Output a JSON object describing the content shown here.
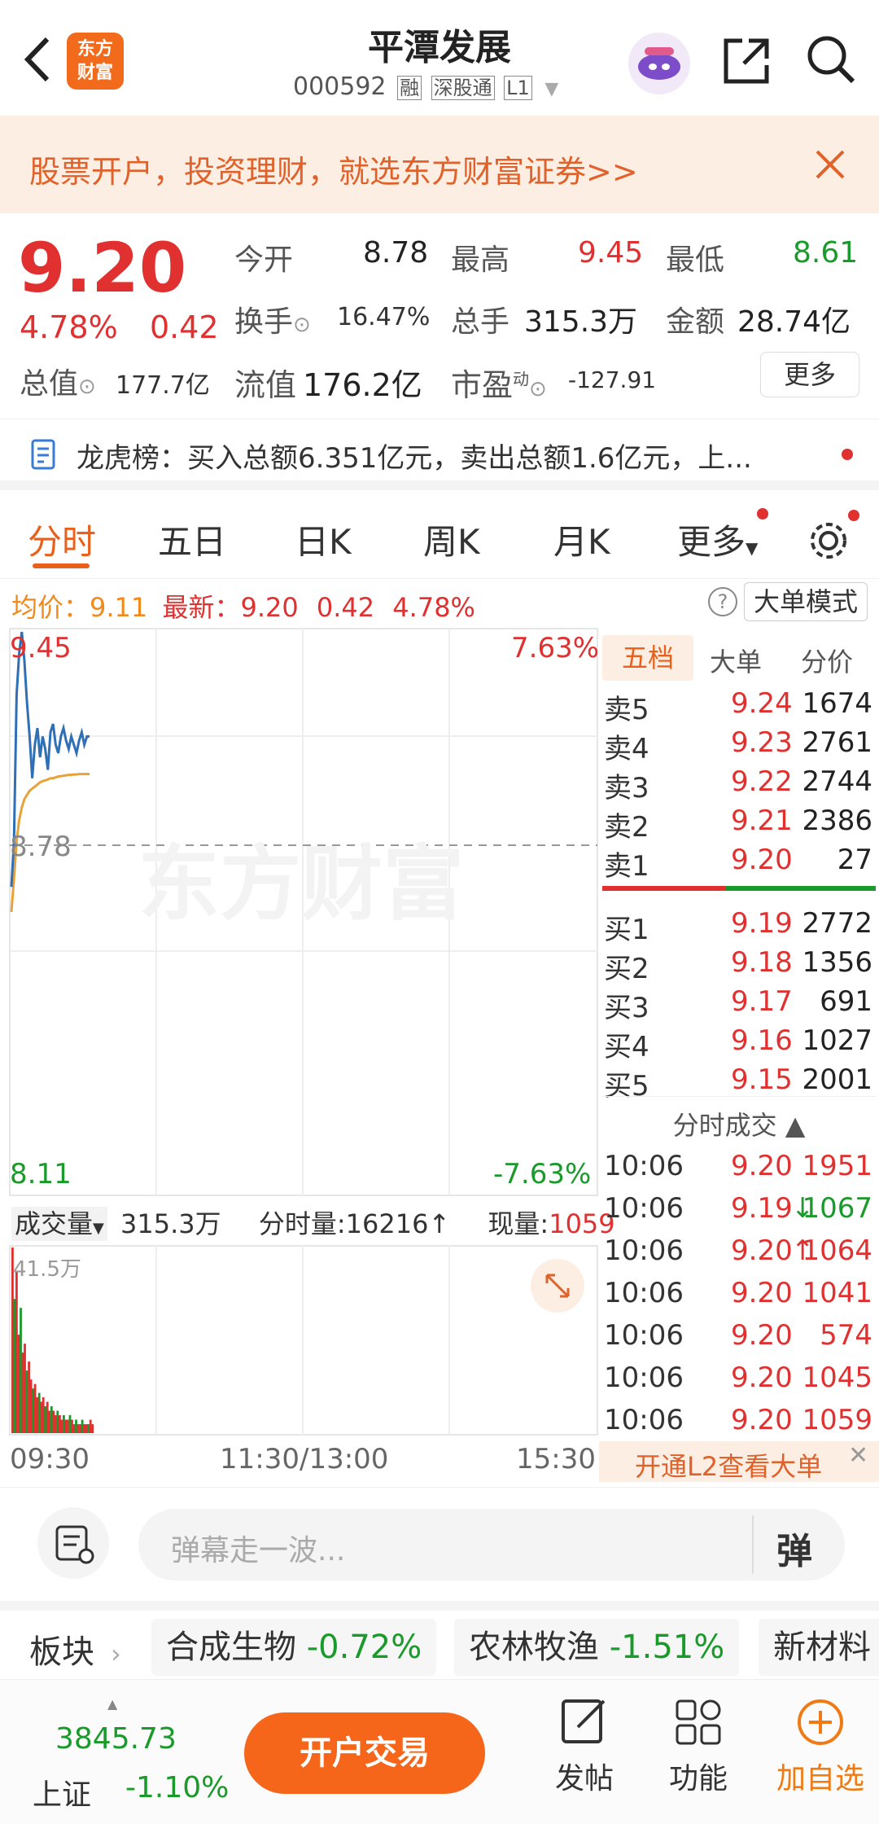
{
  "header": {
    "title": "平潭发展",
    "code": "000592",
    "tags": [
      "融",
      "深股通",
      "L1"
    ],
    "logo_text_top": "东方",
    "logo_text_bottom": "财富"
  },
  "banner": {
    "text": "股票开户，投资理财，就选东方财富证券>>"
  },
  "quote": {
    "price": "9.20",
    "change_pct": "4.78%",
    "change": "0.42",
    "open_label": "今开",
    "open": "8.78",
    "high_label": "最高",
    "high": "9.45",
    "low_label": "最低",
    "low": "8.61",
    "turnover_rate_label": "换手",
    "turnover_rate": "16.47%",
    "volume_label": "总手",
    "volume": "315.3万",
    "amount_label": "金额",
    "amount": "28.74亿",
    "total_mv_label": "总值",
    "total_mv": "177.7亿",
    "float_mv_label": "流值",
    "float_mv": "176.2亿",
    "pe_label": "市盈",
    "pe_sup": "动",
    "pe": "-127.91",
    "more_button": "更多"
  },
  "notice": {
    "text": "龙虎榜：买入总额6.351亿元，卖出总额1.6亿元，上..."
  },
  "tabs": {
    "items": [
      "分时",
      "五日",
      "日K",
      "周K",
      "月K",
      "更多"
    ],
    "active": 0
  },
  "chart_bar": {
    "avg_label": "均价：",
    "avg": "9.11",
    "latest_label": "最新：",
    "latest": "9.20",
    "change": "0.42",
    "change_pct": "4.78%",
    "mode_button": "大单模式"
  },
  "chart_data": {
    "type": "line",
    "price_axis": {
      "max": "9.45",
      "mid": "8.78",
      "min": "8.11",
      "max_pct": "7.63%",
      "min_pct": "-7.63%"
    },
    "time_axis": [
      "09:30",
      "11:30/13:00",
      "15:30"
    ],
    "ylim": [
      8.11,
      9.45
    ],
    "series": [
      {
        "values": [
          8.84,
          8.95,
          9.3,
          9.4,
          9.45,
          9.38,
          9.28,
          9.2,
          9.1,
          9.18,
          9.22,
          9.15,
          9.2,
          9.17,
          9.12,
          9.21,
          9.23,
          9.18,
          9.16,
          9.2,
          9.22,
          9.19,
          9.17,
          9.2,
          9.18,
          9.16,
          9.19,
          9.21,
          9.18,
          9.2,
          9.2
        ]
      },
      {
        "values": [
          8.78,
          8.86,
          8.95,
          9.0,
          9.03,
          9.05,
          9.06,
          9.07,
          9.075,
          9.08,
          9.085,
          9.09,
          9.093,
          9.095,
          9.097,
          9.1,
          9.1,
          9.102,
          9.104,
          9.105,
          9.106,
          9.107,
          9.108,
          9.108,
          9.109,
          9.109,
          9.11,
          9.11,
          9.11,
          9.11,
          9.11
        ]
      }
    ],
    "watermark": "东方财富",
    "volume": {
      "label": "成交量",
      "total": "315.3万",
      "minute_label": "分时量:",
      "minute": "16216↑",
      "current_label": "现量:",
      "current": "1059",
      "max_label": "41.5万",
      "values": [
        41.5,
        30,
        36,
        22,
        28,
        18,
        20,
        14,
        16,
        12,
        10,
        11,
        8,
        9,
        7,
        8,
        6,
        7,
        5,
        6,
        5,
        4,
        5,
        4,
        3,
        4,
        3,
        3,
        4,
        3,
        2,
        3,
        2,
        2,
        3,
        2,
        2,
        2,
        3,
        2
      ]
    }
  },
  "orderbook": {
    "tabs": [
      "五档",
      "大单",
      "分价"
    ],
    "asks": [
      {
        "label": "卖5",
        "price": "9.24",
        "vol": "1674"
      },
      {
        "label": "卖4",
        "price": "9.23",
        "vol": "2761"
      },
      {
        "label": "卖3",
        "price": "9.22",
        "vol": "2744"
      },
      {
        "label": "卖2",
        "price": "9.21",
        "vol": "2386"
      },
      {
        "label": "卖1",
        "price": "9.20",
        "vol": "27"
      }
    ],
    "bids": [
      {
        "label": "买1",
        "price": "9.19",
        "vol": "2772"
      },
      {
        "label": "买2",
        "price": "9.18",
        "vol": "1356"
      },
      {
        "label": "买3",
        "price": "9.17",
        "vol": "691"
      },
      {
        "label": "买4",
        "price": "9.16",
        "vol": "1027"
      },
      {
        "label": "买5",
        "price": "9.15",
        "vol": "2001"
      }
    ],
    "ticks_title": "分时成交",
    "ticks": [
      {
        "time": "10:06",
        "price": "9.20",
        "vol": "1951",
        "arrow": ""
      },
      {
        "time": "10:06",
        "price": "9.19",
        "vol": "1067",
        "arrow": "↓"
      },
      {
        "time": "10:06",
        "price": "9.20",
        "vol": "1064",
        "arrow": "↑"
      },
      {
        "time": "10:06",
        "price": "9.20",
        "vol": "1041",
        "arrow": ""
      },
      {
        "time": "10:06",
        "price": "9.20",
        "vol": "574",
        "arrow": ""
      },
      {
        "time": "10:06",
        "price": "9.20",
        "vol": "1045",
        "arrow": ""
      },
      {
        "time": "10:06",
        "price": "9.20",
        "vol": "1059",
        "arrow": ""
      }
    ],
    "l2_text": "开通L2查看大单"
  },
  "danmu": {
    "placeholder": "弹幕走一波...",
    "toggle": "弹"
  },
  "sector": {
    "label": "板块",
    "items": [
      {
        "name": "合成生物",
        "pct": "-0.72%"
      },
      {
        "name": "农林牧渔",
        "pct": "-1.51%"
      },
      {
        "name": "新材料",
        "pct": ""
      }
    ]
  },
  "bottom": {
    "index_value": "3845.73",
    "index_name": "上证",
    "index_pct": "-1.10%",
    "trade_button": "开户交易",
    "post": "发帖",
    "func": "功能",
    "watch": "加自选"
  },
  "colors": {
    "up": "#e03030",
    "down": "#1a9a2a",
    "accent": "#f07a14",
    "avg_line": "#e8a23a",
    "price_line": "#2e6fb5"
  }
}
